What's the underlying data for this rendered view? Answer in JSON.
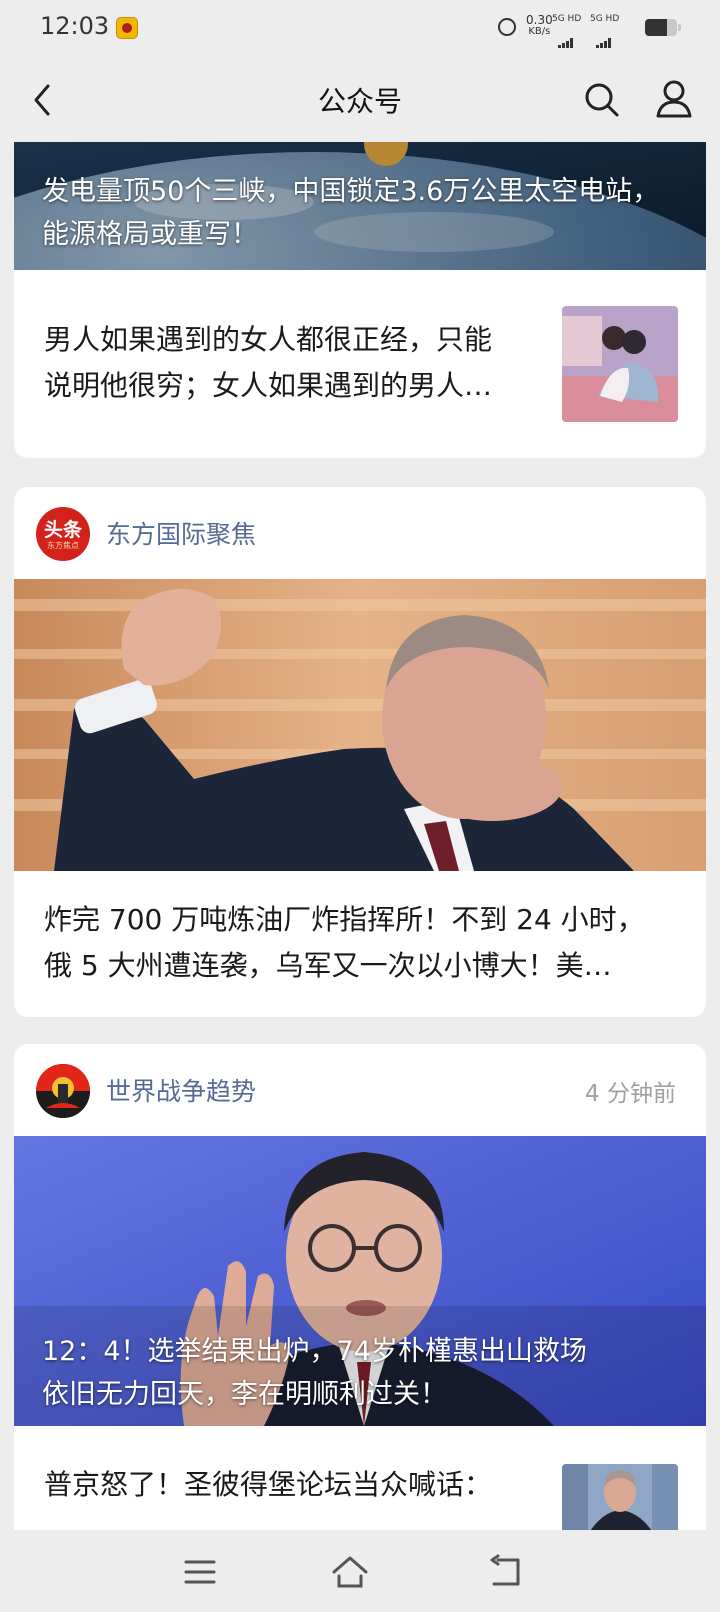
{
  "status": {
    "time": "12:03",
    "net_speed": "0.30",
    "net_unit": "KB/s",
    "sim1": "5G HD",
    "sim2": "5G HD"
  },
  "nav": {
    "title": "公众号"
  },
  "feed": {
    "card1": {
      "banner_title": "发电量顶50个三峡，中国锁定3.6万公里太空电站，能源格局或重写！",
      "item_title_line1": "男人如果遇到的女人都很正经，只能",
      "item_title_line2": "说明他很穷；女人如果遇到的男人…"
    },
    "card2": {
      "account": "东方国际聚焦",
      "avatar_text": "头条",
      "avatar_subtext": "东方焦点",
      "item_title_line1": "炸完 700 万吨炼油厂炸指挥所！不到 24 小时，",
      "item_title_line2": "俄 5 大州遭连袭，乌军又一次以小博大！美…"
    },
    "card3": {
      "account": "世界战争趋势",
      "time_ago": "4 分钟前",
      "banner_title_line1": "12：4！选举结果出炉，74岁朴槿惠出山救场",
      "banner_title_line2": "依旧无力回天，李在明顺利过关！",
      "item_title_line1": "普京怒了！圣彼得堡论坛当众喊话："
    }
  },
  "colors": {
    "page_bg": "#ededed",
    "account_name": "#576b95",
    "card_bg": "#ffffff"
  },
  "icons": {
    "back": "chevron-left-icon",
    "search": "search-icon",
    "profile": "user-icon",
    "menu": "menu-icon",
    "home": "home-icon",
    "return": "return-icon"
  }
}
